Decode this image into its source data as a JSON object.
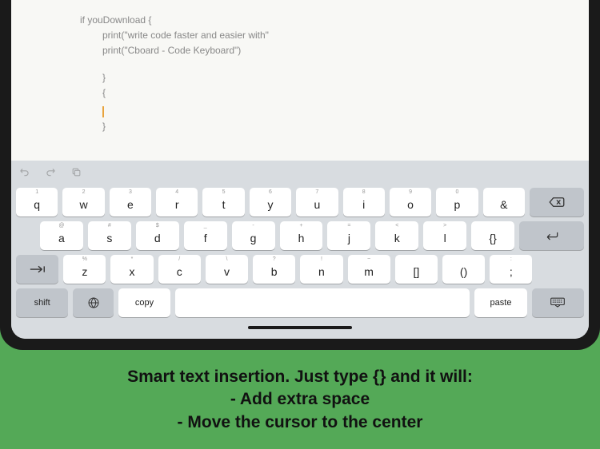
{
  "editor": {
    "line1": "if youDownload {",
    "line2": "print(\"write code faster and easier with\"",
    "line3": "print(\"Cboard - Code Keyboard\")",
    "line4": "}",
    "line5": "{",
    "line6": "}"
  },
  "keyboard": {
    "row1": [
      {
        "top": "1",
        "main": "q"
      },
      {
        "top": "2",
        "main": "w"
      },
      {
        "top": "3",
        "main": "e"
      },
      {
        "top": "4",
        "main": "r"
      },
      {
        "top": "5",
        "main": "t"
      },
      {
        "top": "6",
        "main": "y"
      },
      {
        "top": "7",
        "main": "u"
      },
      {
        "top": "8",
        "main": "i"
      },
      {
        "top": "9",
        "main": "o"
      },
      {
        "top": "0",
        "main": "p"
      },
      {
        "top": "",
        "main": "&"
      }
    ],
    "row2": [
      {
        "top": "@",
        "main": "a"
      },
      {
        "top": "#",
        "main": "s"
      },
      {
        "top": "$",
        "main": "d"
      },
      {
        "top": "_",
        "main": "f"
      },
      {
        "top": "-",
        "main": "g"
      },
      {
        "top": "+",
        "main": "h"
      },
      {
        "top": "=",
        "main": "j"
      },
      {
        "top": "<",
        "main": "k"
      },
      {
        "top": ">",
        "main": "l"
      },
      {
        "top": "",
        "main": "{}"
      }
    ],
    "row3": [
      {
        "top": "%",
        "main": "z"
      },
      {
        "top": "*",
        "main": "x"
      },
      {
        "top": "/",
        "main": "c"
      },
      {
        "top": "\\",
        "main": "v"
      },
      {
        "top": "?",
        "main": "b"
      },
      {
        "top": "!",
        "main": "n"
      },
      {
        "top": "~",
        "main": "m"
      },
      {
        "top": "",
        "main": "[]"
      },
      {
        "top": "",
        "main": "()"
      },
      {
        "top": ":",
        "main": ";"
      }
    ],
    "row4": {
      "shift": "shift",
      "copy": "copy",
      "paste": "paste"
    }
  },
  "promo": {
    "l1": "Smart text insertion. Just type {} and it will:",
    "l2": "- Add extra space",
    "l3": "- Move the cursor to the center"
  }
}
